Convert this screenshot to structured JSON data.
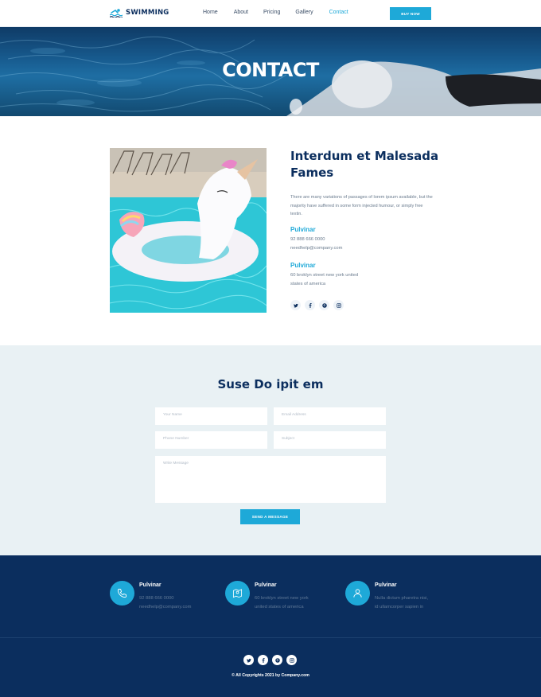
{
  "header": {
    "logo_text": "SWIMMING",
    "nav": [
      "Home",
      "About",
      "Pricing",
      "Gallery",
      "Contact"
    ],
    "active_nav": "Contact",
    "buy_label": "BUY NOW"
  },
  "hero": {
    "title": "CONTACT"
  },
  "about": {
    "title": "Interdum et Malesada Fames",
    "text": "There are many variations of passages of lorem ipsum available, but the majority have suffered in some form injected humour, or simply free textin.",
    "phone_label": "Pulvinar",
    "phone": "92 888 666 0000",
    "email": "needhelp@company.com",
    "address_label": "Pulvinar",
    "address_line1": "60 broklyn street new york united",
    "address_line2": "states of america",
    "social_icons": [
      "twitter-icon",
      "facebook-icon",
      "pinterest-icon",
      "instagram-icon"
    ]
  },
  "form": {
    "title": "Suse Do ipit em",
    "name_placeholder": "Your Name",
    "email_placeholder": "Email Address",
    "phone_placeholder": "Phone Number",
    "subject_placeholder": "Subject",
    "message_placeholder": "Write Message",
    "send_label": "SEND A MESSAGE"
  },
  "footer": {
    "col1": {
      "title": "Pulvinar",
      "line1": "92 888 666 0000",
      "line2": "needhelp@company.com",
      "icon": "phone-icon"
    },
    "col2": {
      "title": "Pulvinar",
      "line1": "60 broklyn street new york",
      "line2": "united states of america",
      "icon": "map-pin-icon"
    },
    "col3": {
      "title": "Pulvinar",
      "line1": "Nulla dictum pharetra nisi,",
      "line2": "id ullamcorper sapien in",
      "icon": "user-icon"
    },
    "social_icons": [
      "twitter-icon",
      "facebook-icon",
      "pinterest-icon",
      "instagram-icon"
    ],
    "copyright": "© All Copyrights 2021 by Company.com"
  },
  "colors": {
    "accent": "#1ea9d8",
    "navy": "#0b2e5e",
    "form_bg": "#e9f1f4"
  }
}
